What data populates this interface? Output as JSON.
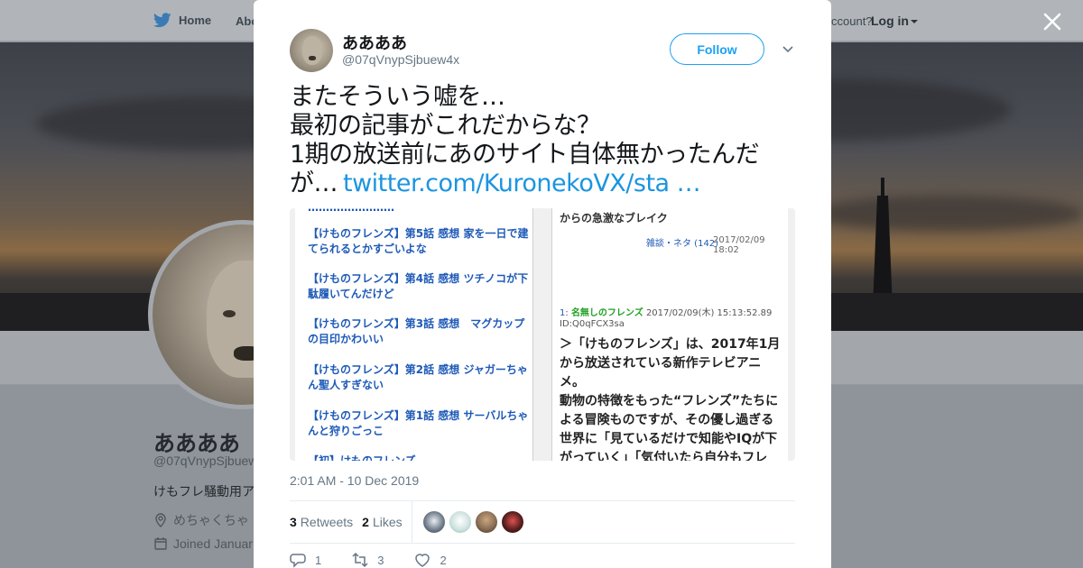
{
  "nav": {
    "home_label": "Home",
    "about_label": "Abo",
    "account_text": "ccount?",
    "login_label": "Log in"
  },
  "profile": {
    "name": "ああああ",
    "handle": "@07qVnypSjbuew",
    "bio": "けもフレ騒動用ア",
    "location": "めちゃくちゃ",
    "joined": "Joined Januar"
  },
  "tweet": {
    "author_name": "ああああ",
    "author_handle": "@07qVnypSjbuew4x",
    "follow_label": "Follow",
    "text_lines": [
      "またそういう嘘を…",
      "最初の記事がこれだからな？",
      "1期の放送前にあのサイト自体無かったんだ",
      "が…"
    ],
    "link_text": "twitter.com/KuronekoVX/sta …",
    "timestamp": "2:01 AM - 10 Dec 2019",
    "retweets_count": "3",
    "retweets_label": "Retweets",
    "likes_count": "2",
    "likes_label": "Likes",
    "likers": [
      "#6b7785",
      "#cfe3e0",
      "#8a6e55",
      "#5a1f1f"
    ],
    "actions": {
      "reply_count": "1",
      "retweet_count": "3",
      "like_count": "2"
    }
  },
  "media": {
    "left_articles": [
      "【けものフレンズ】第5話 感想 家を一日で建てられるとかすごいよな",
      "【けものフレンズ】第4話 感想 ツチノコが下駄履いてんだけど",
      "【けものフレンズ】第3話 感想　マグカップの目印かわいい",
      "【けものフレンズ】第2話 感想 ジャガーちゃん聖人すぎない",
      "【けものフレンズ】第1話 感想 サーバルちゃんと狩りごっこ"
    ],
    "right_top": "からの急激なブレイク",
    "right_category": "雑談・ネタ (142)",
    "right_date": "2017/02/09 18:02",
    "post_number": "1",
    "poster_name": "名無しのフレンズ",
    "post_datetime": "2017/02/09(木) 15:13:52.89",
    "post_id": "ID:Q0qFCX3sa",
    "post_body": "＞「けものフレンズ」は、2017年1月から放送されている新作テレビアニメ。\n動物の特徴をもった“フレンズ”たちによる冒険ものですが、その優し過ぎる世界に「見ているだけで知能やIQが下がっていく」「気付いたら自分もフレ"
  }
}
